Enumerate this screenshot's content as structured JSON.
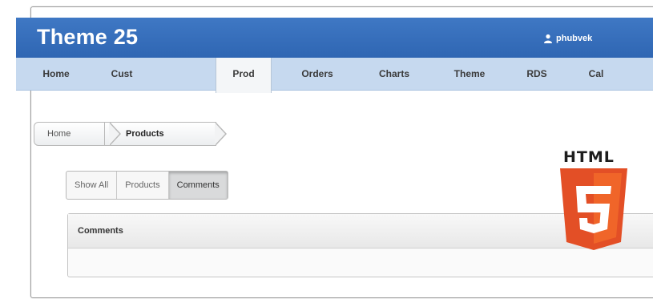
{
  "header": {
    "title": "Theme 25",
    "user_label": "phubvek",
    "icons": {
      "user": "user-icon"
    }
  },
  "navbar": {
    "tabs": [
      {
        "label": "Home"
      },
      {
        "label": "Cust"
      },
      {
        "label": "Prod",
        "active": true
      },
      {
        "label": "Orders"
      },
      {
        "label": "Charts"
      },
      {
        "label": "Theme"
      },
      {
        "label": "RDS"
      },
      {
        "label": "Cal"
      }
    ]
  },
  "breadcrumb": {
    "items": [
      "Home",
      "Products"
    ]
  },
  "filter_buttons": {
    "items": [
      "Show All",
      "Products",
      "Comments"
    ],
    "active": "Comments"
  },
  "panel": {
    "title": "Comments"
  },
  "logo": {
    "text": "HTML",
    "badge": "5",
    "colors": {
      "shield": "#e34f26",
      "shield_dark": "#c94a25",
      "accent": "#ffffff"
    }
  },
  "colors": {
    "header": "#3470bb",
    "navbar": "#c6d9ef"
  }
}
